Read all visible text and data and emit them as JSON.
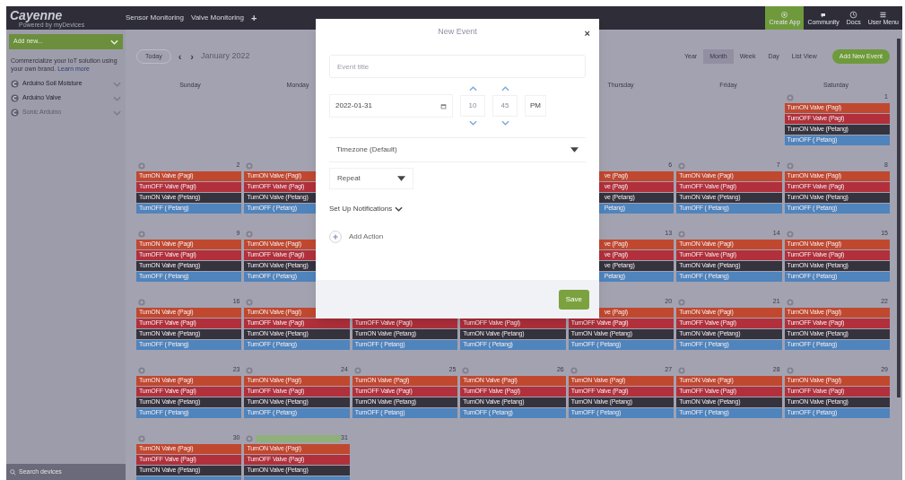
{
  "topbar": {
    "logo": "Cayenne",
    "logo_subtitle": "Powered by myDevices",
    "tabs": [
      "Sensor Monitoring",
      "Valve Monitoring",
      "+"
    ],
    "actions": [
      {
        "label": "Create App",
        "kind": "highlight"
      },
      {
        "label": "Community",
        "kind": "plain"
      },
      {
        "label": "Docs",
        "kind": "plain"
      },
      {
        "label": "User Menu",
        "kind": "plain"
      }
    ]
  },
  "sidebar": {
    "add_button": "Add new...",
    "promo": "Commercialize your IoT solution using your own brand.",
    "promo_link": "Learn more",
    "devices": [
      {
        "name": "Arduino Soil Moisture",
        "disabled": false
      },
      {
        "name": "Arduino Valve",
        "disabled": false
      },
      {
        "name": "Sonic Arduino",
        "disabled": true
      }
    ],
    "search": {
      "placeholder": "Search devices"
    }
  },
  "calendar": {
    "today": "Today",
    "prev": "‹",
    "next": "›",
    "month": "January 2022",
    "views": [
      {
        "label": "Year",
        "selected": false
      },
      {
        "label": "Month",
        "selected": true
      },
      {
        "label": "Week",
        "selected": false
      },
      {
        "label": "Day",
        "selected": false
      },
      {
        "label": "List View",
        "selected": false
      }
    ],
    "add_event": "Add New Event",
    "weekdays": [
      {
        "kind": "shown",
        "label": "Sunday"
      },
      {
        "kind": "shown",
        "label": "Monday"
      },
      {
        "kind": "covered"
      },
      {
        "kind": "covered"
      },
      {
        "kind": "shown",
        "label": "Thursday"
      },
      {
        "kind": "shown",
        "label": "Friday"
      },
      {
        "kind": "shown",
        "label": "Saturday"
      }
    ],
    "weeks": [
      {
        "days": [
          {
            "kind": "blank"
          },
          {
            "kind": "blank"
          },
          {
            "kind": "blank"
          },
          {
            "kind": "blank"
          },
          {
            "kind": "blank"
          },
          {
            "kind": "blank"
          },
          {
            "kind": "day",
            "number": "1",
            "events": [
              {
                "kind": "on_morning",
                "label": "TurnON Valve (Pagi)"
              },
              {
                "kind": "off_morning",
                "label": "TurnOFF Valve (Pagi)"
              },
              {
                "kind": "on_evening",
                "label": "TurnON Valve (Petang)"
              },
              {
                "kind": "off_evening",
                "label": "TurnOFF ( Petang)"
              }
            ]
          }
        ]
      },
      {
        "days": [
          {
            "kind": "day",
            "number": "2",
            "events": [
              {
                "kind": "on_morning",
                "label": "TurnON Valve (Pagi)"
              },
              {
                "kind": "off_morning",
                "label": "TurnOFF Valve (Pagi)"
              },
              {
                "kind": "on_evening",
                "label": "TurnON Valve (Petang)"
              },
              {
                "kind": "off_evening",
                "label": "TurnOFF ( Petang)"
              }
            ]
          },
          {
            "kind": "day",
            "events": [
              {
                "kind": "on_morning",
                "label": "TurnON Valve (Pagi)"
              },
              {
                "kind": "off_morning",
                "label": "TurnOFF Valve (Pagi)"
              },
              {
                "kind": "on_evening",
                "label": "TurnON Valve (Petang)"
              },
              {
                "kind": "off_evening",
                "label": "TurnOFF ( Petang)"
              }
            ]
          },
          {
            "kind": "covered"
          },
          {
            "kind": "covered"
          },
          {
            "kind": "day",
            "number": "6",
            "covered_left": true,
            "events": [
              {
                "kind": "on_morning",
                "label": "ve (Pagi)",
                "covered_left": true
              },
              {
                "kind": "off_morning",
                "label": "ve (Pagi)",
                "covered_left": true
              },
              {
                "kind": "on_evening",
                "label": "ve (Petang)",
                "covered_left": true
              },
              {
                "kind": "off_evening",
                "label": "Petang)",
                "covered_left": true
              }
            ]
          },
          {
            "kind": "day",
            "number": "7",
            "events": [
              {
                "kind": "on_morning",
                "label": "TurnON Valve (Pagi)"
              },
              {
                "kind": "off_morning",
                "label": "TurnOFF Valve (Pagi)"
              },
              {
                "kind": "on_evening",
                "label": "TurnON Valve (Petang)"
              },
              {
                "kind": "off_evening",
                "label": "TurnOFF ( Petang)"
              }
            ]
          },
          {
            "kind": "day",
            "number": "8",
            "events": [
              {
                "kind": "on_morning",
                "label": "TurnON Valve (Pagi)"
              },
              {
                "kind": "off_morning",
                "label": "TurnOFF Valve (Pagi)"
              },
              {
                "kind": "on_evening",
                "label": "TurnON Valve (Petang)"
              },
              {
                "kind": "off_evening",
                "label": "TurnOFF ( Petang)"
              }
            ]
          }
        ]
      },
      {
        "days": [
          {
            "kind": "day",
            "number": "9",
            "events": [
              {
                "kind": "on_morning",
                "label": "TurnON Valve (Pagi)"
              },
              {
                "kind": "off_morning",
                "label": "TurnOFF Valve (Pagi)"
              },
              {
                "kind": "on_evening",
                "label": "TurnON Valve (Petang)"
              },
              {
                "kind": "off_evening",
                "label": "TurnOFF ( Petang)"
              }
            ]
          },
          {
            "kind": "day",
            "events": [
              {
                "kind": "on_morning",
                "label": "TurnON Valve (Pagi)"
              },
              {
                "kind": "off_morning",
                "label": "TurnOFF Valve (Pagi)"
              },
              {
                "kind": "on_evening",
                "label": "TurnON Valve (Petang)"
              },
              {
                "kind": "off_evening",
                "label": "TurnOFF ( Petang)"
              }
            ]
          },
          {
            "kind": "covered"
          },
          {
            "kind": "covered"
          },
          {
            "kind": "day",
            "number": "13",
            "covered_left": true,
            "events": [
              {
                "kind": "on_morning",
                "label": "ve (Pagi)",
                "covered_left": true
              },
              {
                "kind": "off_morning",
                "label": "ve (Pagi)",
                "covered_left": true
              },
              {
                "kind": "on_evening",
                "label": "ve (Petang)",
                "covered_left": true
              },
              {
                "kind": "off_evening",
                "label": "Petang)",
                "covered_left": true
              }
            ]
          },
          {
            "kind": "day",
            "number": "14",
            "events": [
              {
                "kind": "on_morning",
                "label": "TurnON Valve (Pagi)"
              },
              {
                "kind": "off_morning",
                "label": "TurnOFF Valve (Pagi)"
              },
              {
                "kind": "on_evening",
                "label": "TurnON Valve (Petang)"
              },
              {
                "kind": "off_evening",
                "label": "TurnOFF ( Petang)"
              }
            ]
          },
          {
            "kind": "day",
            "number": "15",
            "events": [
              {
                "kind": "on_morning",
                "label": "TurnON Valve (Pagi)"
              },
              {
                "kind": "off_morning",
                "label": "TurnOFF Valve (Pagi)"
              },
              {
                "kind": "on_evening",
                "label": "TurnON Valve (Petang)"
              },
              {
                "kind": "off_evening",
                "label": "TurnOFF ( Petang)"
              }
            ]
          }
        ]
      },
      {
        "days": [
          {
            "kind": "day",
            "number": "16",
            "events": [
              {
                "kind": "on_morning",
                "label": "TurnON Valve (Pagi)"
              },
              {
                "kind": "off_morning",
                "label": "TurnOFF Valve (Pagi)"
              },
              {
                "kind": "on_evening",
                "label": "TurnON Valve (Petang)"
              },
              {
                "kind": "off_evening",
                "label": "TurnOFF ( Petang)"
              }
            ]
          },
          {
            "kind": "day",
            "events": [
              {
                "kind": "on_morning",
                "label": "TurnON Valve (Pagi)"
              },
              {
                "kind": "off_morning",
                "label": "TurnOFF Valve (Pagi)"
              },
              {
                "kind": "on_evening",
                "label": "TurnON Valve (Petang)"
              },
              {
                "kind": "off_evening",
                "label": "TurnOFF ( Petang)"
              }
            ]
          },
          {
            "kind": "day",
            "events": [
              {
                "kind": "covered"
              },
              {
                "kind": "off_morning",
                "label": "TurnOFF Valve (Pagi)"
              },
              {
                "kind": "on_evening",
                "label": "TurnON Valve (Petang)"
              },
              {
                "kind": "off_evening",
                "label": "TurnOFF ( Petang)"
              }
            ]
          },
          {
            "kind": "day",
            "events": [
              {
                "kind": "covered"
              },
              {
                "kind": "off_morning",
                "label": "TurnOFF Valve (Pagi)"
              },
              {
                "kind": "on_evening",
                "label": "TurnON Valve (Petang)"
              },
              {
                "kind": "off_evening",
                "label": "TurnOFF ( Petang)"
              }
            ]
          },
          {
            "kind": "day",
            "number": "20",
            "covered_left": true,
            "events": [
              {
                "kind": "on_morning",
                "label": "ve (Pagi)",
                "covered_left": true
              },
              {
                "kind": "off_morning",
                "label": "TurnOFF Valve (Pagi)"
              },
              {
                "kind": "on_evening",
                "label": "TurnON Valve (Petang)"
              },
              {
                "kind": "off_evening",
                "label": "TurnOFF ( Petang)"
              }
            ]
          },
          {
            "kind": "day",
            "number": "21",
            "events": [
              {
                "kind": "on_morning",
                "label": "TurnON Valve (Pagi)"
              },
              {
                "kind": "off_morning",
                "label": "TurnOFF Valve (Pagi)"
              },
              {
                "kind": "on_evening",
                "label": "TurnON Valve (Petang)"
              },
              {
                "kind": "off_evening",
                "label": "TurnOFF ( Petang)"
              }
            ]
          },
          {
            "kind": "day",
            "number": "22",
            "events": [
              {
                "kind": "on_morning",
                "label": "TurnON Valve (Pagi)"
              },
              {
                "kind": "off_morning",
                "label": "TurnOFF Valve (Pagi)"
              },
              {
                "kind": "on_evening",
                "label": "TurnON Valve (Petang)"
              },
              {
                "kind": "off_evening",
                "label": "TurnOFF ( Petang)"
              }
            ]
          }
        ]
      },
      {
        "days": [
          {
            "kind": "day",
            "number": "23",
            "events": [
              {
                "kind": "on_morning",
                "label": "TurnON Valve (Pagi)"
              },
              {
                "kind": "off_morning",
                "label": "TurnOFF Valve (Pagi)"
              },
              {
                "kind": "on_evening",
                "label": "TurnON Valve (Petang)"
              },
              {
                "kind": "off_evening",
                "label": "TurnOFF ( Petang)"
              }
            ]
          },
          {
            "kind": "day",
            "number": "24",
            "events": [
              {
                "kind": "on_morning",
                "label": "TurnON Valve (Pagi)"
              },
              {
                "kind": "off_morning",
                "label": "TurnOFF Valve (Pagi)"
              },
              {
                "kind": "on_evening",
                "label": "TurnON Valve (Petang)"
              },
              {
                "kind": "off_evening",
                "label": "TurnOFF ( Petang)"
              }
            ]
          },
          {
            "kind": "day",
            "number": "25",
            "events": [
              {
                "kind": "on_morning",
                "label": "TurnON Valve (Pagi)"
              },
              {
                "kind": "off_morning",
                "label": "TurnOFF Valve (Pagi)"
              },
              {
                "kind": "on_evening",
                "label": "TurnON Valve (Petang)"
              },
              {
                "kind": "off_evening",
                "label": "TurnOFF ( Petang)"
              }
            ]
          },
          {
            "kind": "day",
            "number": "26",
            "events": [
              {
                "kind": "on_morning",
                "label": "TurnON Valve (Pagi)"
              },
              {
                "kind": "off_morning",
                "label": "TurnOFF Valve (Pagi)"
              },
              {
                "kind": "on_evening",
                "label": "TurnON Valve (Petang)"
              },
              {
                "kind": "off_evening",
                "label": "TurnOFF ( Petang)"
              }
            ]
          },
          {
            "kind": "day",
            "number": "27",
            "events": [
              {
                "kind": "on_morning",
                "label": "TurnON Valve (Pagi)"
              },
              {
                "kind": "off_morning",
                "label": "TurnOFF Valve (Pagi)"
              },
              {
                "kind": "on_evening",
                "label": "TurnON Valve (Petang)"
              },
              {
                "kind": "off_evening",
                "label": "TurnOFF ( Petang)"
              }
            ]
          },
          {
            "kind": "day",
            "number": "28",
            "events": [
              {
                "kind": "on_morning",
                "label": "TurnON Valve (Pagi)"
              },
              {
                "kind": "off_morning",
                "label": "TurnOFF Valve (Pagi)"
              },
              {
                "kind": "on_evening",
                "label": "TurnON Valve (Petang)"
              },
              {
                "kind": "off_evening",
                "label": "TurnOFF ( Petang)"
              }
            ]
          },
          {
            "kind": "day",
            "number": "29",
            "events": [
              {
                "kind": "on_morning",
                "label": "TurnON Valve (Pagi)"
              },
              {
                "kind": "off_morning",
                "label": "TurnOFF Valve (Pagi)"
              },
              {
                "kind": "on_evening",
                "label": "TurnON Valve (Petang)"
              },
              {
                "kind": "off_evening",
                "label": "TurnOFF ( Petang)"
              }
            ]
          }
        ]
      },
      {
        "days": [
          {
            "kind": "day",
            "number": "30",
            "events": [
              {
                "kind": "on_morning",
                "label": "TurnON Valve (Pagi)"
              },
              {
                "kind": "off_morning",
                "label": "TurnOFF Valve (Pagi)"
              },
              {
                "kind": "on_evening",
                "label": "TurnON Valve (Petang)"
              },
              {
                "kind": "off_evening"
              }
            ]
          },
          {
            "kind": "day",
            "number": "31",
            "today": true,
            "events": [
              {
                "kind": "on_morning",
                "label": "TurnON Valve (Pagi)"
              },
              {
                "kind": "off_morning",
                "label": "TurnOFF Valve (Pagi)"
              },
              {
                "kind": "on_evening",
                "label": "TurnON Valve (Petang)"
              },
              {
                "kind": "off_evening"
              }
            ]
          },
          {
            "kind": "blank"
          },
          {
            "kind": "blank"
          },
          {
            "kind": "blank"
          },
          {
            "kind": "blank"
          },
          {
            "kind": "blank"
          }
        ]
      }
    ]
  },
  "modal": {
    "title": "New Event",
    "close": "×",
    "title_field": {
      "placeholder": "Event title"
    },
    "date": "2022-01-31",
    "hour": "10",
    "minute": "45",
    "meridiem": "PM",
    "timezone": "Timezone (Default)",
    "repeat": "Repeat",
    "notifications": "Set Up Notifications",
    "add_action": "Add Action",
    "save": "Save"
  }
}
